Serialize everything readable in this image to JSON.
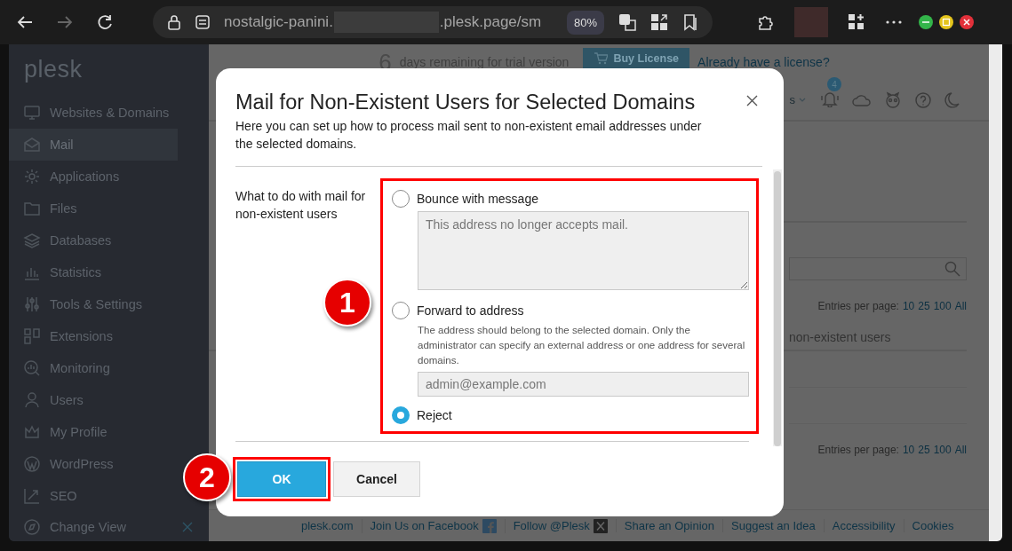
{
  "browser": {
    "address_start": "nostalgic-panini.",
    "address_end": ".plesk.page/sm",
    "zoom": "80%"
  },
  "sidebar": {
    "logo": "plesk",
    "items": [
      {
        "label": "Websites & Domains",
        "selected": false
      },
      {
        "label": "Mail",
        "selected": true
      },
      {
        "label": "Applications",
        "selected": false
      },
      {
        "label": "Files",
        "selected": false
      },
      {
        "label": "Databases",
        "selected": false
      },
      {
        "label": "Statistics",
        "selected": false
      },
      {
        "label": "Tools & Settings",
        "selected": false
      },
      {
        "label": "Extensions",
        "selected": false
      },
      {
        "label": "Monitoring",
        "selected": false
      },
      {
        "label": "Users",
        "selected": false
      },
      {
        "label": "My Profile",
        "selected": false
      },
      {
        "label": "WordPress",
        "selected": false
      },
      {
        "label": "SEO",
        "selected": false
      }
    ],
    "footer_item": "Change View"
  },
  "trial": {
    "days": "6",
    "text": "days remaining for trial version",
    "buy_button": "Buy License",
    "license_link": "Already have a license?"
  },
  "toolbar": {
    "menu_fragment": "s",
    "notification_count": "4"
  },
  "list": {
    "heading_fragment": "non-existent users",
    "pagers": [
      {
        "label": "Entries per page:",
        "options": [
          "10",
          "25",
          "100",
          "All"
        ]
      },
      {
        "label": "Entries per page:",
        "options": [
          "10",
          "25",
          "100",
          "All"
        ]
      }
    ]
  },
  "footer": {
    "links": [
      {
        "label": "plesk.com",
        "kind": "plain"
      },
      {
        "label": "Join Us on Facebook",
        "kind": "facebook"
      },
      {
        "label": "Follow @Plesk",
        "kind": "x"
      },
      {
        "label": "Share an Opinion",
        "kind": "plain"
      },
      {
        "label": "Suggest an Idea",
        "kind": "plain"
      },
      {
        "label": "Accessibility",
        "kind": "plain"
      },
      {
        "label": "Cookies",
        "kind": "plain"
      }
    ]
  },
  "dialog": {
    "title": "Mail for Non-Existent Users for Selected Domains",
    "description": "Here you can set up how to process mail sent to non-existent email addresses under the selected domains.",
    "field_label": "What to do with mail for non-existent users",
    "options": [
      {
        "kind": "textarea",
        "label": "Bounce with message",
        "selected": false,
        "value": "This address no longer accepts mail.",
        "disabled": true
      },
      {
        "kind": "input",
        "label": "Forward to address",
        "selected": false,
        "hint": "The address should belong to the selected domain. Only the administrator can specify an external address or one address for several domains.",
        "placeholder": "admin@example.com",
        "disabled": true
      },
      {
        "kind": "plain",
        "label": "Reject",
        "selected": true
      }
    ],
    "buttons": [
      {
        "label": "OK",
        "kind": "primary"
      },
      {
        "label": "Cancel",
        "kind": "secondary"
      }
    ]
  },
  "callouts": [
    {
      "number": "1"
    },
    {
      "number": "2"
    }
  ]
}
